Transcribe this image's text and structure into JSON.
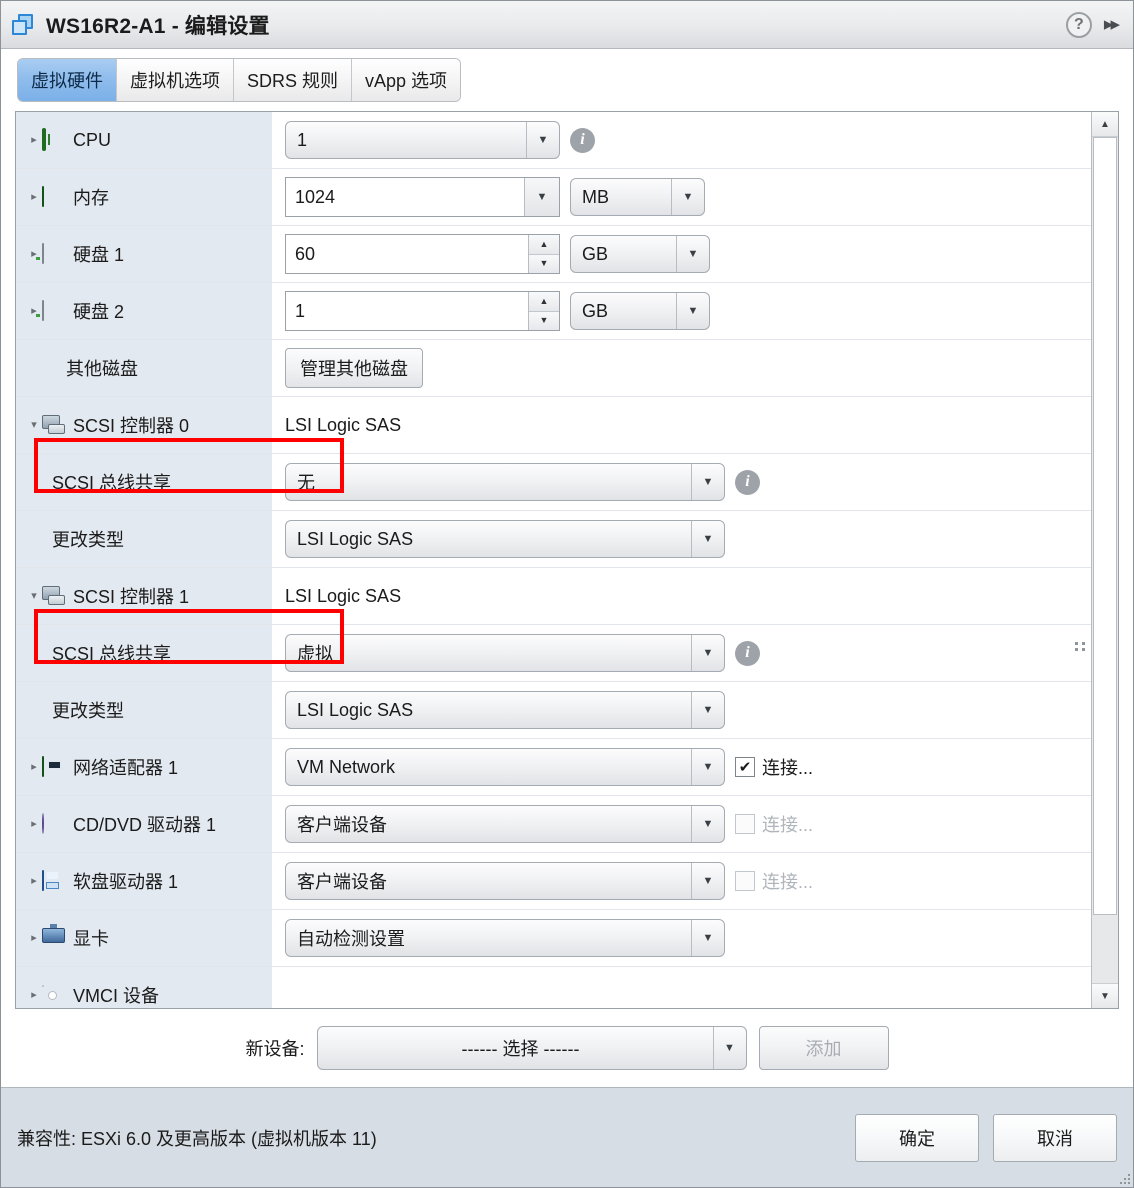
{
  "window": {
    "title": "WS16R2-A1 - 编辑设置",
    "vm_icon": "virtual-machine-icon",
    "help_icon": "?",
    "expand_icon": "▸▸"
  },
  "tabs": [
    {
      "label": "虚拟硬件",
      "active": true
    },
    {
      "label": "虚拟机选项",
      "active": false
    },
    {
      "label": "SDRS 规则",
      "active": false
    },
    {
      "label": "vApp 选项",
      "active": false
    }
  ],
  "hardware_rows": [
    {
      "name": "cpu",
      "label": "CPU",
      "icon": "cpu-icon",
      "twisty": "▸",
      "control": "combo",
      "value": "1",
      "info": true
    },
    {
      "name": "memory",
      "label": "内存",
      "icon": "memory-icon",
      "twisty": "▸",
      "control": "textcombo",
      "value": "1024",
      "unit": "MB"
    },
    {
      "name": "hard-disk-1",
      "label": "硬盘 1",
      "icon": "hard-disk-icon",
      "twisty": "▸",
      "control": "spinner",
      "value": "60",
      "unit": "GB"
    },
    {
      "name": "hard-disk-2",
      "label": "硬盘 2",
      "icon": "hard-disk-icon",
      "twisty": "▸",
      "control": "spinner",
      "value": "1",
      "unit": "GB"
    },
    {
      "name": "other-disks",
      "label": "其他磁盘",
      "icon": null,
      "twisty": "",
      "control": "button",
      "value": "管理其他磁盘"
    },
    {
      "name": "scsi-controller-0",
      "label": "SCSI 控制器 0",
      "icon": "scsi-controller-icon",
      "twisty": "▾",
      "control": "text",
      "value": "LSI Logic SAS"
    },
    {
      "name": "scsi-bus-sharing-0",
      "label": "SCSI 总线共享",
      "icon": null,
      "twisty": "",
      "sub": true,
      "control": "wide-combo",
      "value": "无",
      "info": true,
      "highlight": true
    },
    {
      "name": "change-type-0",
      "label": "更改类型",
      "icon": null,
      "twisty": "",
      "sub": true,
      "control": "combo-wide",
      "value": "LSI Logic SAS"
    },
    {
      "name": "scsi-controller-1",
      "label": "SCSI 控制器 1",
      "icon": "scsi-controller-icon",
      "twisty": "▾",
      "control": "text",
      "value": "LSI Logic SAS"
    },
    {
      "name": "scsi-bus-sharing-1",
      "label": "SCSI 总线共享",
      "icon": null,
      "twisty": "",
      "sub": true,
      "control": "wide-combo",
      "value": "虚拟",
      "info": true,
      "highlight": true
    },
    {
      "name": "change-type-1",
      "label": "更改类型",
      "icon": null,
      "twisty": "",
      "sub": true,
      "control": "combo-wide",
      "value": "LSI Logic SAS"
    },
    {
      "name": "network-adapter-1",
      "label": "网络适配器 1",
      "icon": "network-adapter-icon",
      "twisty": "▸",
      "control": "combo-net",
      "value": "VM Network",
      "checkbox": {
        "label": "连接...",
        "checked": true,
        "enabled": true
      }
    },
    {
      "name": "cd-dvd-drive-1",
      "label": "CD/DVD 驱动器 1",
      "icon": "cd-dvd-icon",
      "twisty": "▸",
      "control": "combo-net",
      "value": "客户端设备",
      "checkbox": {
        "label": "连接...",
        "checked": false,
        "enabled": false
      }
    },
    {
      "name": "floppy-drive-1",
      "label": "软盘驱动器 1",
      "icon": "floppy-icon",
      "twisty": "▸",
      "control": "combo-net",
      "value": "客户端设备",
      "checkbox": {
        "label": "连接...",
        "checked": false,
        "enabled": false
      }
    },
    {
      "name": "video-card",
      "label": "显卡",
      "icon": "video-card-icon",
      "twisty": "▸",
      "control": "combo-net",
      "value": "自动检测设置"
    },
    {
      "name": "vmci-device",
      "label": "VMCI 设备",
      "icon": "vmci-icon",
      "twisty": "▸",
      "control": "none",
      "value": ""
    }
  ],
  "scrollbar": {
    "up_arrow": "▲",
    "down_arrow": "▼"
  },
  "new_device": {
    "label": "新设备:",
    "selected": "------ 选择 ------",
    "add_button": "添加",
    "add_enabled": false
  },
  "footer": {
    "compatibility": "兼容性: ESXi 6.0 及更高版本 (虚拟机版本 11)",
    "ok_button": "确定",
    "cancel_button": "取消"
  },
  "colors": {
    "highlight": "#ff0000",
    "active_tab": "#8fbcec",
    "label_column": "#e3e9f0",
    "footer_bg": "#d7dde4"
  }
}
